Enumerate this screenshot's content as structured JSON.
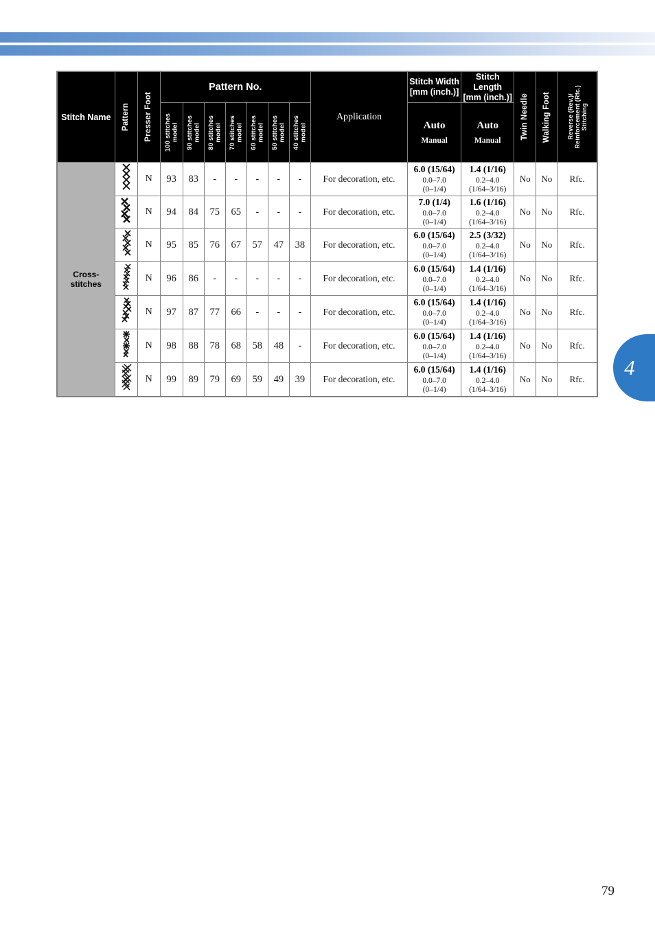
{
  "page": {
    "number": "79",
    "chapter_tab": "4",
    "accent_color": "#2f7ac4",
    "banner_gradient_start": "#5b8ecb",
    "banner_gradient_end": "#eef2fa"
  },
  "table": {
    "headers": {
      "stitch_name": "Stitch Name",
      "pattern": "Pattern",
      "presser_foot": "Presser Foot",
      "pattern_no": "Pattern No.",
      "models": [
        "100 stitches model",
        "90 stitches model",
        "80 stitches model",
        "70 stitches model",
        "60 stitches model",
        "50 stitches model",
        "40 stitches model"
      ],
      "application": "Application",
      "stitch_width": "Stitch Width [mm (inch.)]",
      "stitch_length": "Stitch Length [mm (inch.)]",
      "auto": "Auto",
      "manual": "Manual",
      "twin_needle": "Twin Needle",
      "walking_foot": "Walking Foot",
      "reverse_reinforcement": "Reverse (Rev.)/ Reinforcement (Rfc.) Stitching"
    },
    "group_label": "Cross-stitches",
    "rows": [
      {
        "pattern_icon": "cross-stitch-diamond-chain",
        "presser_foot": "N",
        "model_numbers": [
          "93",
          "83",
          "-",
          "-",
          "-",
          "-",
          "-"
        ],
        "application": "For decoration, etc.",
        "width_auto": "6.0 (15/64)",
        "width_range_mm": "0.0–7.0",
        "width_range_inch": "(0–1/4)",
        "length_auto": "1.4 (1/16)",
        "length_range_mm": "0.2–4.0",
        "length_range_inch": "(1/64–3/16)",
        "twin_needle": "No",
        "walking_foot": "No",
        "reverse_reinforcement": "Rfc."
      },
      {
        "pattern_icon": "cross-stitch-zigzag-x-large",
        "presser_foot": "N",
        "model_numbers": [
          "94",
          "84",
          "75",
          "65",
          "-",
          "-",
          "-"
        ],
        "application": "For decoration, etc.",
        "width_auto": "7.0 (1/4)",
        "width_range_mm": "0.0–7.0",
        "width_range_inch": "(0–1/4)",
        "length_auto": "1.6 (1/16)",
        "length_range_mm": "0.2–4.0",
        "length_range_inch": "(1/64–3/16)",
        "twin_needle": "No",
        "walking_foot": "No",
        "reverse_reinforcement": "Rfc."
      },
      {
        "pattern_icon": "cross-stitch-zigzag-x-small",
        "presser_foot": "N",
        "model_numbers": [
          "95",
          "85",
          "76",
          "67",
          "57",
          "47",
          "38"
        ],
        "application": "For decoration, etc.",
        "width_auto": "6.0 (15/64)",
        "width_range_mm": "0.0–7.0",
        "width_range_inch": "(0–1/4)",
        "length_auto": "2.5 (3/32)",
        "length_range_mm": "0.2–4.0",
        "length_range_inch": "(1/64–3/16)",
        "twin_needle": "No",
        "walking_foot": "No",
        "reverse_reinforcement": "Rfc."
      },
      {
        "pattern_icon": "cross-stitch-dense-diagonal",
        "presser_foot": "N",
        "model_numbers": [
          "96",
          "86",
          "-",
          "-",
          "-",
          "-",
          "-"
        ],
        "application": "For decoration, etc.",
        "width_auto": "6.0 (15/64)",
        "width_range_mm": "0.0–7.0",
        "width_range_inch": "(0–1/4)",
        "length_auto": "1.4 (1/16)",
        "length_range_mm": "0.2–4.0",
        "length_range_inch": "(1/64–3/16)",
        "twin_needle": "No",
        "walking_foot": "No",
        "reverse_reinforcement": "Rfc."
      },
      {
        "pattern_icon": "cross-stitch-branch",
        "presser_foot": "N",
        "model_numbers": [
          "97",
          "87",
          "77",
          "66",
          "-",
          "-",
          "-"
        ],
        "application": "For decoration, etc.",
        "width_auto": "6.0 (15/64)",
        "width_range_mm": "0.0–7.0",
        "width_range_inch": "(0–1/4)",
        "length_auto": "1.4 (1/16)",
        "length_range_mm": "0.2–4.0",
        "length_range_inch": "(1/64–3/16)",
        "twin_needle": "No",
        "walking_foot": "No",
        "reverse_reinforcement": "Rfc."
      },
      {
        "pattern_icon": "cross-stitch-star-chain",
        "presser_foot": "N",
        "model_numbers": [
          "98",
          "88",
          "78",
          "68",
          "58",
          "48",
          "-"
        ],
        "application": "For decoration, etc.",
        "width_auto": "6.0 (15/64)",
        "width_range_mm": "0.0–7.0",
        "width_range_inch": "(0–1/4)",
        "length_auto": "1.4 (1/16)",
        "length_range_mm": "0.2–4.0",
        "length_range_inch": "(1/64–3/16)",
        "twin_needle": "No",
        "walking_foot": "No",
        "reverse_reinforcement": "Rfc."
      },
      {
        "pattern_icon": "cross-stitch-dense-block",
        "presser_foot": "N",
        "model_numbers": [
          "99",
          "89",
          "79",
          "69",
          "59",
          "49",
          "39"
        ],
        "application": "For decoration, etc.",
        "width_auto": "6.0 (15/64)",
        "width_range_mm": "0.0–7.0",
        "width_range_inch": "(0–1/4)",
        "length_auto": "1.4 (1/16)",
        "length_range_mm": "0.2–4.0",
        "length_range_inch": "(1/64–3/16)",
        "twin_needle": "No",
        "walking_foot": "No",
        "reverse_reinforcement": "Rfc."
      }
    ]
  }
}
